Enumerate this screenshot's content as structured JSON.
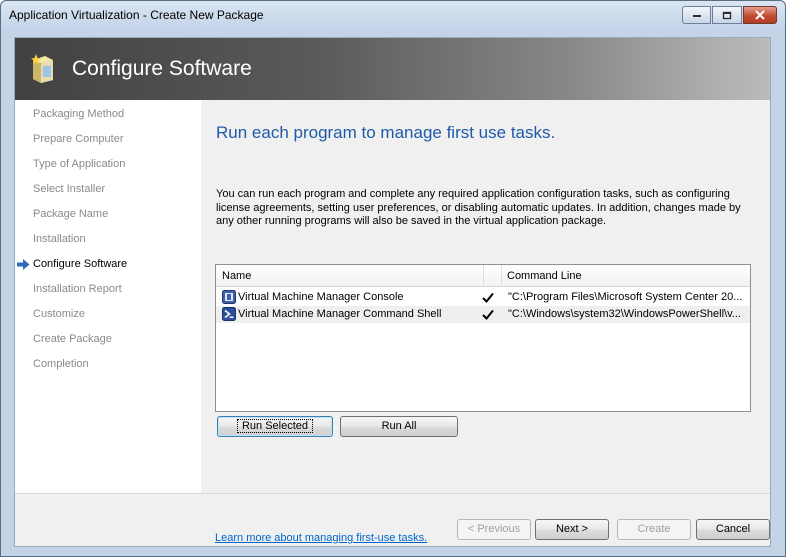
{
  "window": {
    "title": "Application Virtualization - Create New Package"
  },
  "banner": {
    "title": "Configure Software",
    "icon": "package-wizard-icon"
  },
  "sidebar": {
    "items": [
      {
        "label": "Packaging Method",
        "current": false
      },
      {
        "label": "Prepare Computer",
        "current": false
      },
      {
        "label": "Type of Application",
        "current": false
      },
      {
        "label": "Select Installer",
        "current": false
      },
      {
        "label": "Package Name",
        "current": false
      },
      {
        "label": "Installation",
        "current": false
      },
      {
        "label": "Configure Software",
        "current": true
      },
      {
        "label": "Installation Report",
        "current": false
      },
      {
        "label": "Customize",
        "current": false
      },
      {
        "label": "Create Package",
        "current": false
      },
      {
        "label": "Completion",
        "current": false
      }
    ]
  },
  "main": {
    "heading": "Run each program to manage first use tasks.",
    "description": "You can run each program and complete any required application configuration tasks, such as configuring license agreements, setting user preferences, or disabling automatic updates. In addition, changes made by any other running programs will also be saved in the virtual application package.",
    "table": {
      "columns": [
        "Name",
        "Command Line"
      ],
      "rows": [
        {
          "name": "Virtual Machine Manager Console",
          "checked": true,
          "command": "\"C:\\Program Files\\Microsoft System Center 20...",
          "icon": "console-app-icon"
        },
        {
          "name": "Virtual Machine Manager Command Shell",
          "checked": true,
          "command": "\"C:\\Windows\\system32\\WindowsPowerShell\\v...",
          "icon": "powershell-icon"
        }
      ]
    },
    "run_selected_label": "Run Selected",
    "run_all_label": "Run All",
    "learn_more_link": "Learn more about managing first-use tasks."
  },
  "footer": {
    "previous_label": "< Previous",
    "next_label": "Next >",
    "create_label": "Create",
    "cancel_label": "Cancel"
  },
  "colors": {
    "heading": "#1e5aa8",
    "link": "#0066cc",
    "nav_inactive": "#8a8a8a",
    "nav_arrow": "#2f6bb5"
  }
}
